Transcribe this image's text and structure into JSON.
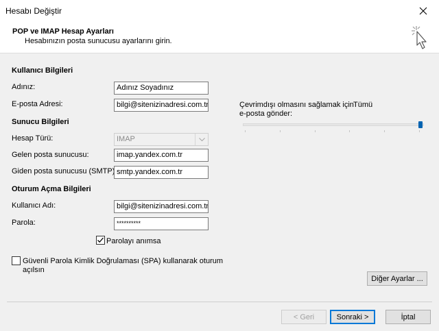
{
  "window": {
    "title": "Hesabı Değiştir"
  },
  "header": {
    "title": "POP ve IMAP Hesap Ayarları",
    "subtitle": "Hesabınızın posta sunucusu ayarlarını girin."
  },
  "user_info": {
    "section": "Kullanıcı Bilgileri",
    "name_label": "Adınız:",
    "name_value": "Adınız Soyadınız",
    "email_label": "E-posta Adresi:",
    "email_value": "bilgi@sitenizinadresi.com.tr"
  },
  "server_info": {
    "section": "Sunucu Bilgileri",
    "account_type_label": "Hesap Türü:",
    "account_type_value": "IMAP",
    "incoming_label": "Gelen posta sunucusu:",
    "incoming_value": "imap.yandex.com.tr",
    "outgoing_label": "Giden posta sunucusu (SMTP):",
    "outgoing_value": "smtp.yandex.com.tr"
  },
  "logon_info": {
    "section": "Oturum Açma Bilgileri",
    "username_label": "Kullanıcı Adı:",
    "username_value": "bilgi@sitenizinadresi.com.tr",
    "password_label": "Parola:",
    "password_value": "**********",
    "remember_label": "Parolayı anımsa",
    "remember_checked": true,
    "spa_label_line1": "Güvenli Parola Kimlik Doğrulaması (SPA) kullanarak oturum",
    "spa_label_line2": "açılsın",
    "spa_checked": false
  },
  "offline": {
    "label_line1": "Çevrimdışı olmasını sağlamak için",
    "label_line2": "e-posta gönder:",
    "value": "Tümü",
    "slider_level": 1.0
  },
  "buttons": {
    "more_settings": "Diğer Ayarlar ...",
    "back": "< Geri",
    "next": "Sonraki >",
    "cancel": "İptal"
  },
  "icons": {
    "close": "close-icon",
    "cursor": "click-cursor-icon",
    "check": "checkmark-icon",
    "dropdown": "chevron-down-icon"
  }
}
